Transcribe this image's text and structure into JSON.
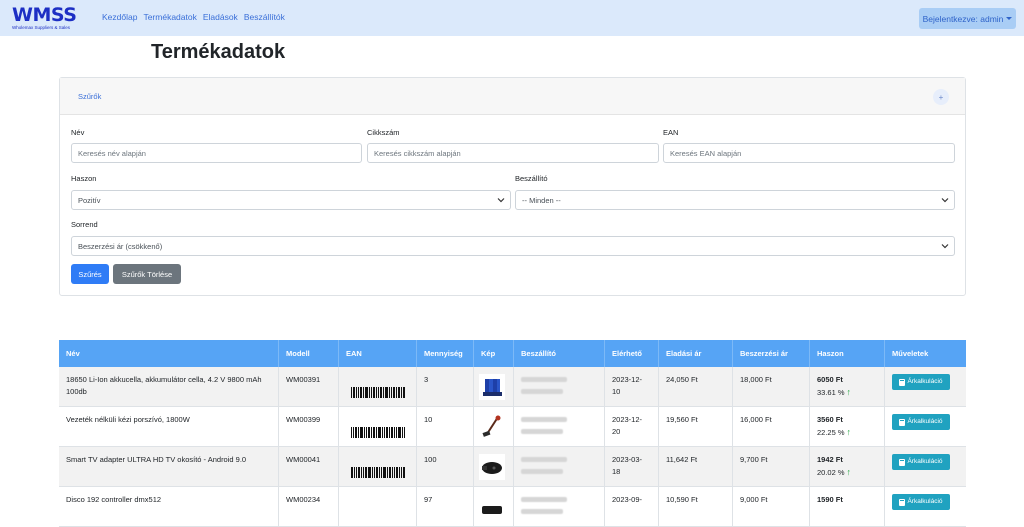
{
  "navbar": {
    "brand": "WMSS",
    "brand_sub": "Wholemax Suppliers & Sales",
    "links": [
      "Kezdőlap",
      "Termékadatok",
      "Eladások",
      "Beszállítók"
    ],
    "login": "Bejelentkezve: admin"
  },
  "page_title": "Termékadatok",
  "filters": {
    "header": "Szűrők",
    "toggle": "+",
    "name_label": "Név",
    "name_placeholder": "Keresés név alapján",
    "sku_label": "Cikkszám",
    "sku_placeholder": "Keresés cikkszám alapján",
    "ean_label": "EAN",
    "ean_placeholder": "Keresés EAN alapján",
    "profit_label": "Haszon",
    "profit_value": "Pozitív",
    "supplier_label": "Beszállító",
    "supplier_value": "-- Minden --",
    "order_label": "Sorrend",
    "order_value": "Beszerzési ár (csökkenő)",
    "filter_button": "Szűrés",
    "clear_button": "Szűrők Törlése"
  },
  "table": {
    "headers": [
      "Név",
      "Modell",
      "EAN",
      "Mennyiség",
      "Kép",
      "Beszállító",
      "Elérhető",
      "Eladási ár",
      "Beszerzési ár",
      "Haszon",
      "Műveletek"
    ],
    "rows": [
      {
        "name": "18650 Li-Ion akkucella, akkumulátor cella, 4.2 V 9800 mAh 100db",
        "model": "WM00391",
        "qty": "3",
        "date_a": "2023-12-",
        "date_b": "10",
        "sale": "24,050 Ft",
        "purchase": "18,000 Ft",
        "profit": "6050 Ft",
        "percent": "33.61 %",
        "action": "Árkalkuláció"
      },
      {
        "name": "Vezeték nélküli kézi porszívó, 1800W",
        "model": "WM00399",
        "qty": "10",
        "date_a": "2023-12-",
        "date_b": "20",
        "sale": "19,560 Ft",
        "purchase": "16,000 Ft",
        "profit": "3560 Ft",
        "percent": "22.25 %",
        "action": "Árkalkuláció"
      },
      {
        "name": "Smart TV adapter ULTRA HD TV okosító - Android 9.0",
        "model": "WM00041",
        "qty": "100",
        "date_a": "2023-03-",
        "date_b": "18",
        "sale": "11,642 Ft",
        "purchase": "9,700 Ft",
        "profit": "1942 Ft",
        "percent": "20.02 %",
        "action": "Árkalkuláció"
      },
      {
        "name": "Disco 192 controller dmx512",
        "model": "WM00234",
        "qty": "97",
        "date_a": "2023-09-",
        "date_b": "",
        "sale": "10,590 Ft",
        "purchase": "9,000 Ft",
        "profit": "1590 Ft",
        "percent": "",
        "action": "Árkalkuláció"
      }
    ]
  },
  "colors": {
    "navbar_bg": "#dbe9fb",
    "brand": "#1d2fc4",
    "header_bg": "#56a4f5",
    "primary": "#2f7cf6",
    "info": "#20a2c0",
    "positive": "#28a745"
  }
}
